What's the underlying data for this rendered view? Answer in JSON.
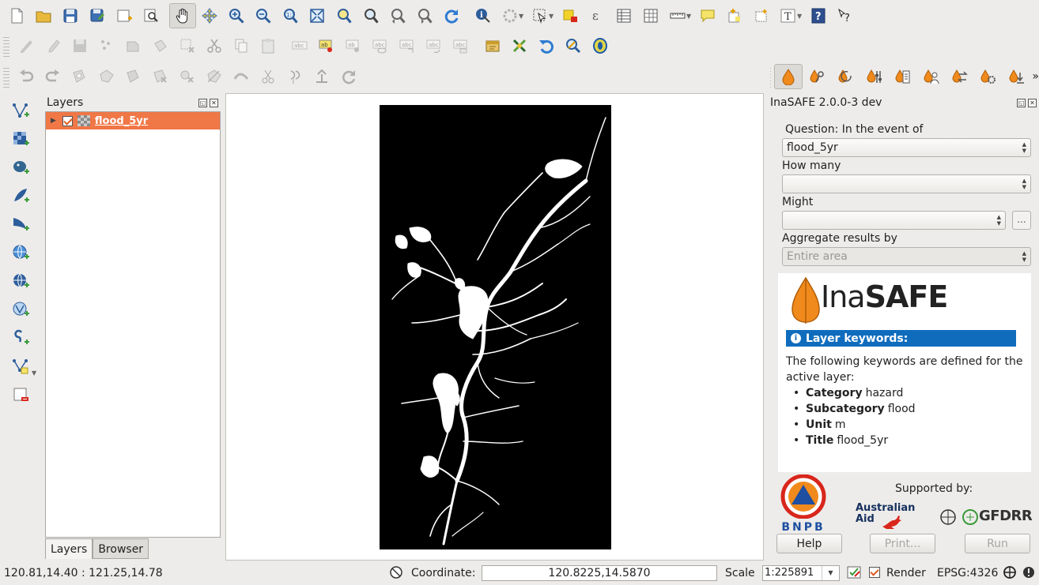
{
  "toolbar": {
    "file_icons": [
      "new-project-icon",
      "open-project-icon",
      "save-project-icon",
      "save-as-icon",
      "new-print-composer-icon",
      "composer-manager-icon"
    ],
    "nav_icons": [
      "pan-icon",
      "pan-to-selection-icon",
      "zoom-in-icon",
      "zoom-out-icon",
      "zoom-native-icon",
      "zoom-full-icon",
      "zoom-to-selection-icon",
      "zoom-to-layer-icon",
      "zoom-last-icon",
      "zoom-next-icon",
      "refresh-icon"
    ],
    "attr_icons": [
      "identify-icon",
      "action-icon",
      "select-icon",
      "deselect-icon",
      "expression-select-icon",
      "attribute-table-icon",
      "field-calculator-icon",
      "measure-icon",
      "annotation-icon",
      "new-bookmark-icon",
      "show-bookmarks-icon",
      "text-annotation-icon",
      "help-icon",
      "whats-this-icon"
    ],
    "digitize_icons": [
      "current-edits-icon",
      "toggle-editing-icon",
      "save-edits-icon",
      "add-feature-icon",
      "move-feature-icon",
      "node-tool-icon",
      "delete-selected-icon",
      "cut-features-icon",
      "copy-features-icon",
      "paste-features-icon"
    ],
    "label_icons": [
      "label-settings-icon",
      "pin-labels-icon",
      "highlight-pinned-icon",
      "show-hide-labels-icon",
      "move-label-icon",
      "rotate-label-icon",
      "change-label-icon"
    ],
    "plugin_icons": [
      "python-console-icon",
      "georeferencer-icon",
      "undo-icon",
      "gps-icon",
      "osm-icon"
    ],
    "advanced_icons": [
      "undo-edit-icon",
      "redo-edit-icon",
      "add-ring-icon",
      "add-part-icon",
      "fill-ring-icon",
      "delete-ring-icon",
      "delete-part-icon",
      "reshape-icon",
      "offset-curve-icon",
      "split-features-icon",
      "split-parts-icon",
      "merge-features-icon",
      "rotate-point-icon"
    ]
  },
  "inasafe_toolbar": {
    "icons": [
      "inasafe-dock-icon",
      "keywords-editor-icon",
      "reload-icon",
      "options-icon",
      "impact-functions-icon",
      "minimum-needs-icon",
      "converter-icon",
      "batch-runner-icon",
      "save-scenario-icon"
    ],
    "overflow": "»"
  },
  "left_tools": [
    "add-vector-layer-icon",
    "add-raster-layer-icon",
    "add-postgis-layer-icon",
    "add-spatialite-layer-icon",
    "add-mssql-layer-icon",
    "add-wms-layer-icon",
    "add-wcs-layer-icon",
    "add-wfs-layer-icon",
    "add-delimited-text-icon",
    "new-shapefile-icon",
    "remove-layer-icon"
  ],
  "layers_panel": {
    "title": "Layers",
    "layers": [
      {
        "name": "flood_5yr",
        "checked": true
      }
    ],
    "tabs": [
      "Layers",
      "Browser"
    ],
    "active_tab": "Layers"
  },
  "inasafe": {
    "title": "InaSAFE 2.0.0-3 dev",
    "question_label": "Question: In the event of",
    "hazard_value": "flood_5yr",
    "how_many_label": "How many",
    "how_many_value": "",
    "might_label": "Might",
    "might_value": "",
    "might_button": "...",
    "aggregate_label": "Aggregate results by",
    "aggregate_value": "Entire area",
    "logo_text_light": "Ina",
    "logo_text_bold": "SAFE",
    "keywords_header": "Layer keywords:",
    "keywords_intro": "The following keywords are defined for the active layer:",
    "keywords": [
      {
        "key": "Category",
        "value": "hazard"
      },
      {
        "key": "Subcategory",
        "value": "flood"
      },
      {
        "key": "Unit",
        "value": "m"
      },
      {
        "key": "Title",
        "value": "flood_5yr"
      }
    ],
    "supported_by": "Supported by:",
    "bnpb_label": "BNPB",
    "aus_aid_line1": "Australian",
    "aus_aid_line2": "Aid",
    "gfdrr_label": "GFDRR",
    "help_button": "Help",
    "print_button": "Print...",
    "run_button": "Run"
  },
  "status": {
    "extent": "120.81,14.40 : 121.25,14.78",
    "coordinate_label": "Coordinate:",
    "coordinate_value": "120.8225,14.5870",
    "scale_label": "Scale",
    "scale_value": "1:225891",
    "render_label": "Render",
    "render_checked": true,
    "crs": "EPSG:4326"
  },
  "colors": {
    "layer_highlight": "#f07746",
    "keywords_bar": "#0f6cbd",
    "inasafe_orange": "#f08a1c",
    "map_raster": "#000000"
  }
}
